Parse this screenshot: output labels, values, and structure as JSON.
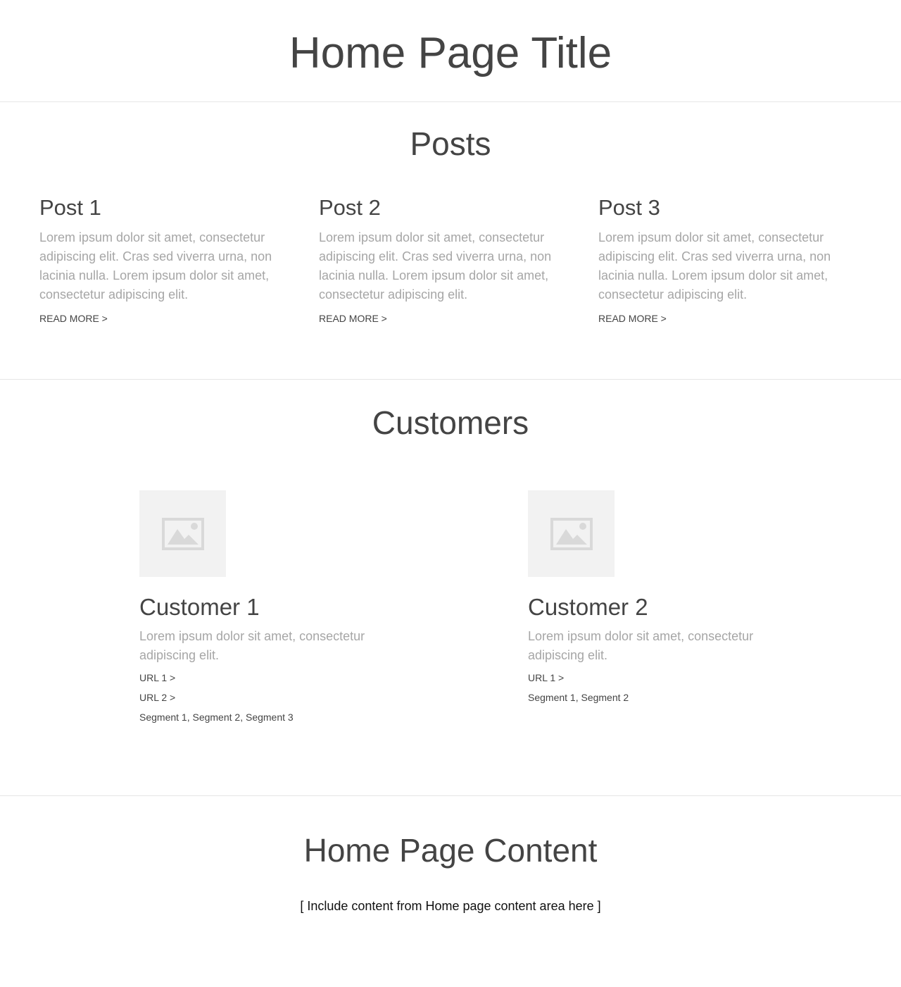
{
  "header": {
    "title": "Home Page Title"
  },
  "posts": {
    "section_title": "Posts",
    "items": [
      {
        "title": "Post 1",
        "excerpt": "Lorem ipsum dolor sit amet, consectetur adipiscing elit. Cras sed viverra urna, non lacinia nulla. Lorem ipsum dolor sit amet, consectetur adipiscing elit.",
        "read_more": "READ MORE >"
      },
      {
        "title": "Post 2",
        "excerpt": "Lorem ipsum dolor sit amet, consectetur adipiscing elit. Cras sed viverra urna, non lacinia nulla. Lorem ipsum dolor sit amet, consectetur adipiscing elit.",
        "read_more": "READ MORE >"
      },
      {
        "title": "Post 3",
        "excerpt": "Lorem ipsum dolor sit amet, consectetur adipiscing elit. Cras sed viverra urna, non lacinia nulla. Lorem ipsum dolor sit amet, consectetur adipiscing elit.",
        "read_more": "READ MORE >"
      }
    ]
  },
  "customers": {
    "section_title": "Customers",
    "image_icon": "image-placeholder-icon",
    "items": [
      {
        "name": "Customer 1",
        "description": "Lorem ipsum dolor sit amet, consectetur adipiscing elit.",
        "links": [
          "URL 1 >",
          "URL 2 >"
        ],
        "segments": "Segment 1, Segment 2, Segment 3"
      },
      {
        "name": "Customer 2",
        "description": "Lorem ipsum dolor sit amet, consectetur adipiscing elit.",
        "links": [
          "URL 1 >"
        ],
        "segments": "Segment 1, Segment 2"
      }
    ]
  },
  "home_content": {
    "section_title": "Home Page Content",
    "placeholder": "[ Include content from Home page content area here ]"
  },
  "colors": {
    "heading": "#444444",
    "muted_text": "#a6a6a6",
    "divider": "#e6e6e6",
    "image_bg": "#f2f2f2",
    "image_icon": "#d9d9d9"
  }
}
